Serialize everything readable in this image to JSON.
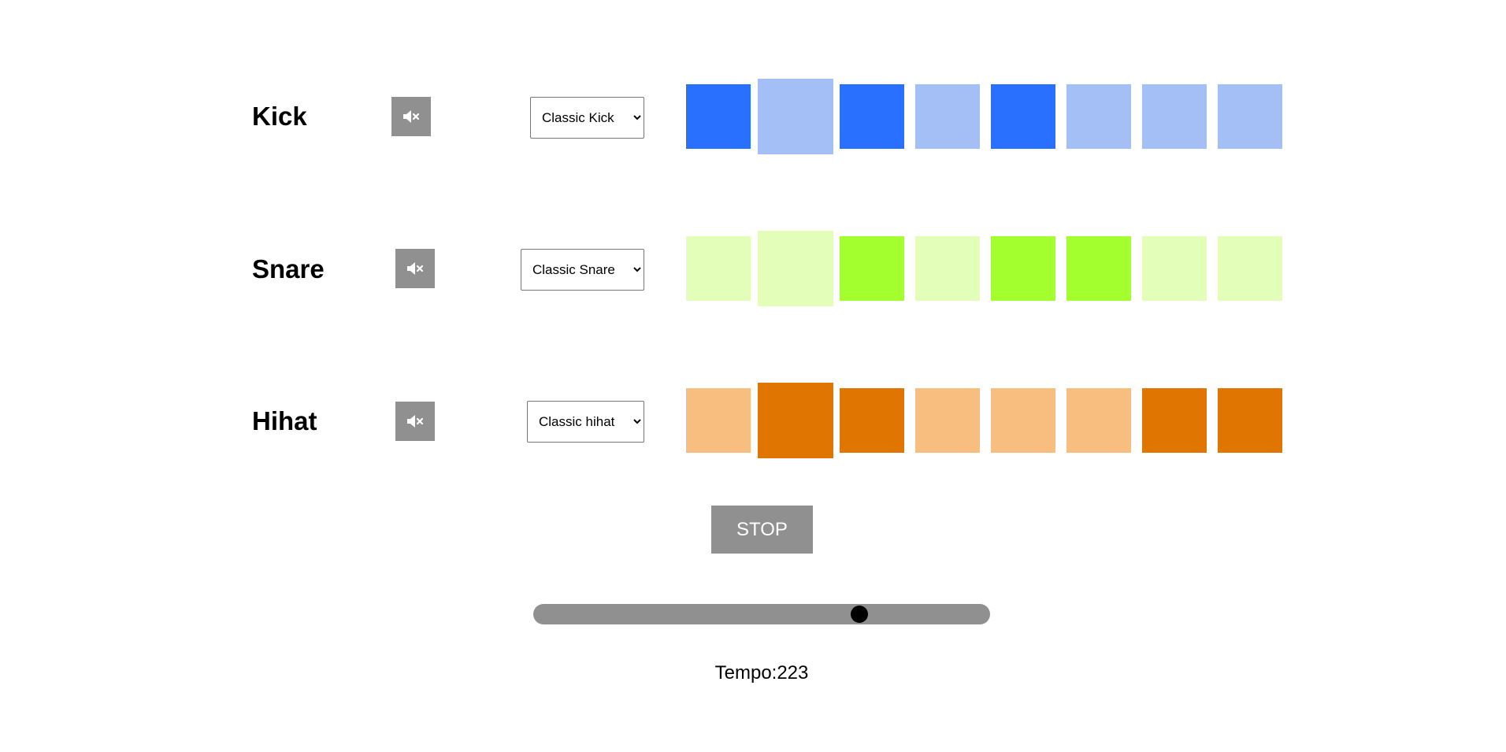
{
  "tracks": [
    {
      "name": "Kick",
      "sound": "Classic Kick",
      "mute_icon": "speaker-muted-icon",
      "colors": {
        "on": "#2970ff",
        "off": "#a3bff5"
      },
      "steps": [
        true,
        false,
        true,
        false,
        true,
        false,
        false,
        false
      ]
    },
    {
      "name": "Snare",
      "sound": "Classic Snare",
      "mute_icon": "speaker-muted-icon",
      "colors": {
        "on": "#a3ff2e",
        "off": "#e2feb8"
      },
      "steps": [
        false,
        false,
        true,
        false,
        true,
        true,
        false,
        false
      ]
    },
    {
      "name": "Hihat",
      "sound": "Classic hihat",
      "mute_icon": "speaker-muted-icon",
      "colors": {
        "on": "#e07502",
        "off": "#f7be80"
      },
      "steps": [
        false,
        true,
        true,
        false,
        false,
        false,
        true,
        true
      ]
    }
  ],
  "current_step": 2,
  "transport": {
    "stop_label": "STOP"
  },
  "tempo": {
    "label": "Tempo:223",
    "value": 223,
    "slider_fraction": 0.713
  }
}
